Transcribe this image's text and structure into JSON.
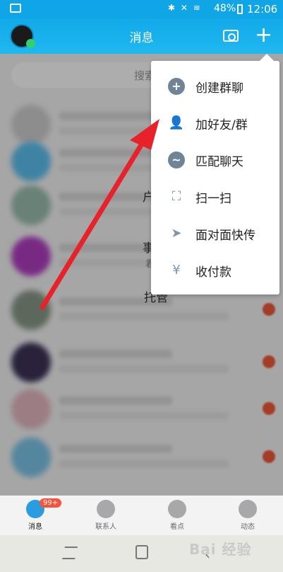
{
  "statusbar": {
    "signal_icons": "✱ ✕ ≋",
    "battery": "48%",
    "time": "12:06"
  },
  "header": {
    "title": "消息",
    "icons": [
      "avatar",
      "camera-icon",
      "plus-icon"
    ]
  },
  "search": {
    "placeholder": "搜索"
  },
  "menu": {
    "items": [
      {
        "icon": "create-group-icon",
        "label": "创建群聊"
      },
      {
        "icon": "add-friend-icon",
        "label": "加好友/群"
      },
      {
        "icon": "match-chat-icon",
        "label": "匹配聊天"
      },
      {
        "icon": "scan-icon",
        "label": "扫一扫"
      },
      {
        "icon": "face-transfer-icon",
        "label": "面对面快传"
      },
      {
        "icon": "payment-icon",
        "label": "收付款"
      }
    ]
  },
  "fragments": [
    "户",
    "事",
    "君",
    "托管"
  ],
  "tabbar": {
    "tabs": [
      {
        "label": "消息",
        "badge": "99+",
        "active": true
      },
      {
        "label": "联系人"
      },
      {
        "label": "看点"
      },
      {
        "label": "动态"
      }
    ]
  },
  "watermark": "Bai 经验",
  "colors": {
    "header": "#12a9ea",
    "arrow": "#e8222b",
    "badge": "#f5533d",
    "menu_icon": "#7f96a7"
  }
}
